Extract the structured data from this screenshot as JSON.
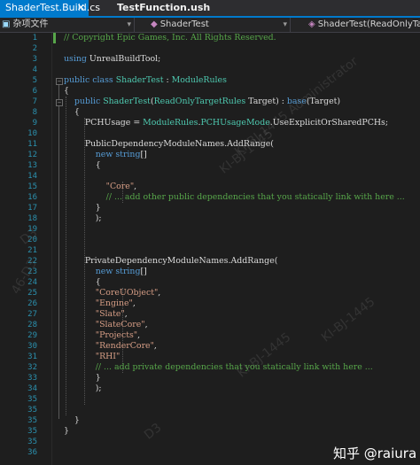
{
  "tabs": [
    {
      "label": "ShaderTest.Build.cs",
      "close": "✕",
      "active": true
    },
    {
      "label": "TestFunction.ush",
      "active": false
    }
  ],
  "nav": {
    "project": "杂项文件",
    "class": "ShaderTest",
    "member": "ShaderTest(ReadOnlyTargetRules Target)"
  },
  "icons": {
    "nav_project": "file-icon",
    "nav_class": "class-icon",
    "nav_member": "method-icon",
    "dropdown": "chevron-down-icon"
  },
  "colors": {
    "accent": "#007acc",
    "background": "#1e1e1e",
    "keyword": "#569cd6",
    "type": "#4ec9b0",
    "string": "#d69d85",
    "comment": "#57a64a",
    "line_number": "#2b91af"
  },
  "editor": {
    "lines": [
      {
        "n": "1",
        "segs": [
          {
            "t": "// Copyright Epic Games, Inc. All Rights Reserved.",
            "c": "cm"
          }
        ]
      },
      {
        "n": "2",
        "segs": []
      },
      {
        "n": "3",
        "segs": [
          {
            "t": "using ",
            "c": "kw"
          },
          {
            "t": "UnrealBuildTool;",
            "c": ""
          }
        ]
      },
      {
        "n": "4",
        "segs": []
      },
      {
        "n": "5",
        "segs": [
          {
            "t": "public ",
            "c": "kw"
          },
          {
            "t": "class ",
            "c": "kw"
          },
          {
            "t": "ShaderTest",
            "c": "ty"
          },
          {
            "t": " : ",
            "c": ""
          },
          {
            "t": "ModuleRules",
            "c": "ty"
          }
        ]
      },
      {
        "n": "6",
        "segs": [
          {
            "t": "{",
            "c": ""
          }
        ]
      },
      {
        "n": "7",
        "segs": [
          {
            "t": "    public ",
            "c": "kw"
          },
          {
            "t": "ShaderTest",
            "c": "ty"
          },
          {
            "t": "(",
            "c": ""
          },
          {
            "t": "ReadOnlyTargetRules",
            "c": "ty"
          },
          {
            "t": " Target) : ",
            "c": ""
          },
          {
            "t": "base",
            "c": "kw"
          },
          {
            "t": "(Target)",
            "c": ""
          }
        ]
      },
      {
        "n": "8",
        "segs": [
          {
            "t": "    {",
            "c": ""
          }
        ]
      },
      {
        "n": "9",
        "segs": [
          {
            "t": "        PCHUsage = ",
            "c": ""
          },
          {
            "t": "ModuleRules",
            "c": "ty"
          },
          {
            "t": ".",
            "c": ""
          },
          {
            "t": "PCHUsageMode",
            "c": "ty"
          },
          {
            "t": ".UseExplicitOrSharedPCHs;",
            "c": ""
          }
        ]
      },
      {
        "n": "10",
        "segs": []
      },
      {
        "n": "11",
        "segs": [
          {
            "t": "        PublicDependencyModuleNames.AddRange(",
            "c": ""
          }
        ]
      },
      {
        "n": "12",
        "segs": [
          {
            "t": "            new ",
            "c": "kw"
          },
          {
            "t": "string",
            "c": "kw"
          },
          {
            "t": "[]",
            "c": ""
          }
        ]
      },
      {
        "n": "13",
        "segs": [
          {
            "t": "            {",
            "c": ""
          }
        ]
      },
      {
        "n": "14",
        "segs": []
      },
      {
        "n": "15",
        "segs": [
          {
            "t": "                \"Core\"",
            "c": "str"
          },
          {
            "t": ",",
            "c": ""
          }
        ]
      },
      {
        "n": "16",
        "segs": [
          {
            "t": "                // ... add other public dependencies that you statically link with here ...",
            "c": "cm"
          }
        ]
      },
      {
        "n": "17",
        "segs": [
          {
            "t": "            }",
            "c": ""
          }
        ]
      },
      {
        "n": "18",
        "segs": [
          {
            "t": "            );",
            "c": ""
          }
        ]
      },
      {
        "n": "19",
        "segs": []
      },
      {
        "n": "20",
        "segs": []
      },
      {
        "n": "21",
        "segs": []
      },
      {
        "n": "22",
        "segs": [
          {
            "t": "        PrivateDependencyModuleNames.AddRange(",
            "c": ""
          }
        ]
      },
      {
        "n": "23",
        "segs": [
          {
            "t": "            new ",
            "c": "kw"
          },
          {
            "t": "string",
            "c": "kw"
          },
          {
            "t": "[]",
            "c": ""
          }
        ]
      },
      {
        "n": "24",
        "segs": [
          {
            "t": "            {",
            "c": ""
          }
        ]
      },
      {
        "n": "25",
        "segs": [
          {
            "t": "            \"CoreUObject\"",
            "c": "str"
          },
          {
            "t": ",",
            "c": ""
          }
        ]
      },
      {
        "n": "26",
        "segs": [
          {
            "t": "            \"Engine\"",
            "c": "str"
          },
          {
            "t": ",",
            "c": ""
          }
        ]
      },
      {
        "n": "27",
        "segs": [
          {
            "t": "            \"Slate\"",
            "c": "str"
          },
          {
            "t": ",",
            "c": ""
          }
        ]
      },
      {
        "n": "28",
        "segs": [
          {
            "t": "            \"SlateCore\"",
            "c": "str"
          },
          {
            "t": ",",
            "c": ""
          }
        ]
      },
      {
        "n": "29",
        "segs": [
          {
            "t": "            \"Projects\"",
            "c": "str"
          },
          {
            "t": ",",
            "c": ""
          }
        ]
      },
      {
        "n": "30",
        "segs": [
          {
            "t": "            \"RenderCore\"",
            "c": "str"
          },
          {
            "t": ",",
            "c": ""
          }
        ]
      },
      {
        "n": "31",
        "segs": [
          {
            "t": "            \"RHI\"",
            "c": "str"
          }
        ]
      },
      {
        "n": "32",
        "segs": [
          {
            "t": "            // ... add private dependencies that you statically link with here ...",
            "c": "cm"
          }
        ]
      },
      {
        "n": "33",
        "segs": [
          {
            "t": "            }",
            "c": ""
          }
        ]
      },
      {
        "n": "34",
        "segs": [
          {
            "t": "            );",
            "c": ""
          }
        ]
      },
      {
        "n": "35",
        "segs": []
      },
      {
        "n": "35",
        "segs": []
      },
      {
        "n": "35",
        "segs": [
          {
            "t": "    }",
            "c": ""
          }
        ]
      },
      {
        "n": "35",
        "segs": [
          {
            "t": "}",
            "c": ""
          }
        ]
      },
      {
        "n": "35",
        "segs": []
      },
      {
        "n": "36",
        "segs": []
      }
    ]
  },
  "watermarks": [
    "KI-BJ-1445  Administrator",
    "KI-BJ-1445",
    "KI-BJ-1445",
    "KI-BJ-1445",
    "D3",
    "46-D3",
    "D3"
  ],
  "footer": {
    "site": "知乎 @raiura"
  }
}
